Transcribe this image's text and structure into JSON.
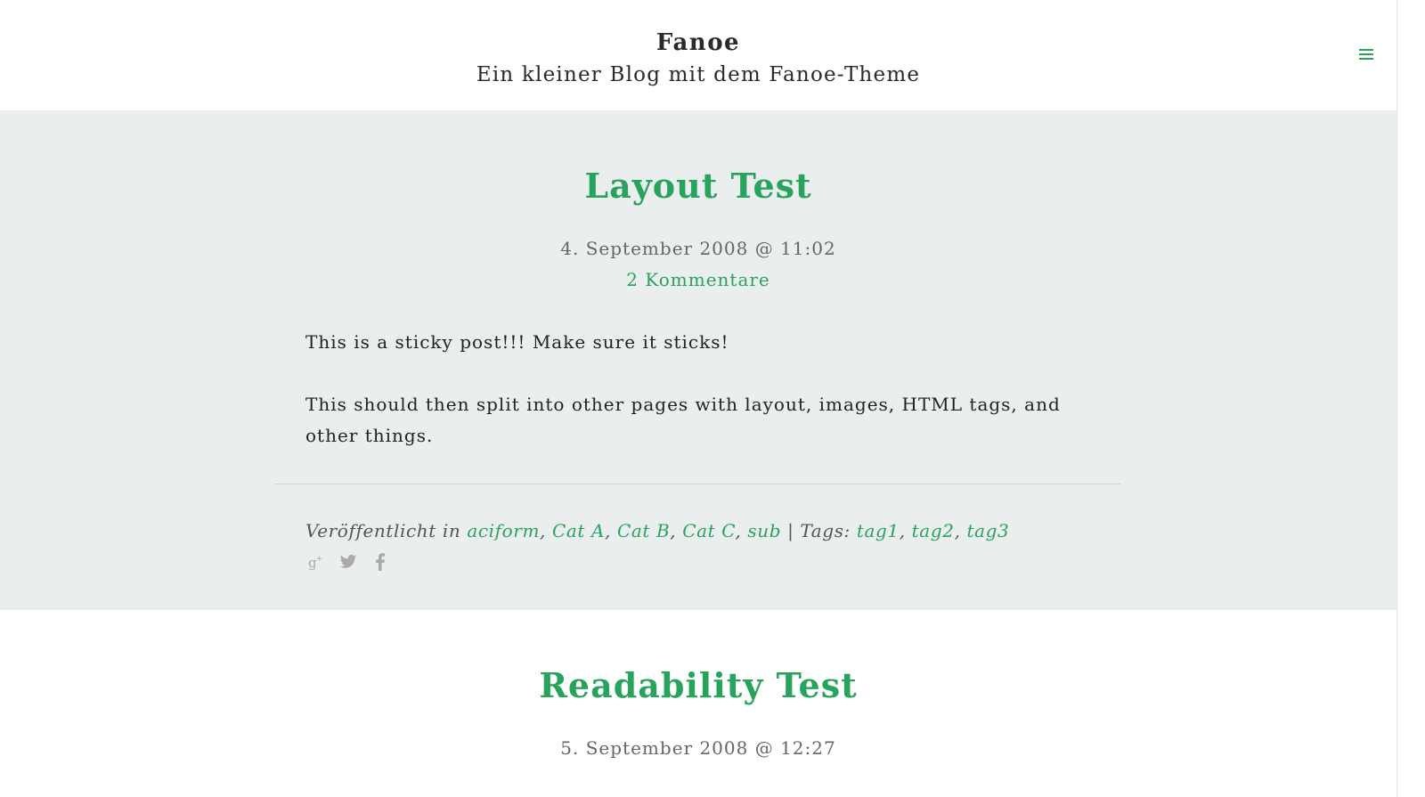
{
  "header": {
    "title": "Fanoe",
    "tagline": "Ein kleiner Blog mit dem Fanoe-Theme",
    "menu_icon": "hamburger-menu-icon"
  },
  "accent_color": "#27a35b",
  "posts": [
    {
      "title": "Layout Test",
      "date": "4. September 2008 @ 11:02",
      "comments": "2 Kommentare",
      "paragraphs": [
        "This is a sticky post!!! Make sure it sticks!",
        "This should then split into other pages with layout, images, HTML tags, and other things."
      ],
      "meta": {
        "published_in_label": "Veröffentlicht in",
        "categories": [
          "aciform",
          "Cat A",
          "Cat B",
          "Cat C",
          "sub"
        ],
        "tags_label": "Tags:",
        "tags": [
          "tag1",
          "tag2",
          "tag3"
        ],
        "separator": "|"
      },
      "share_icons": [
        "google-plus-icon",
        "twitter-icon",
        "facebook-icon"
      ]
    },
    {
      "title": "Readability Test",
      "date": "5. September 2008 @ 12:27"
    }
  ]
}
